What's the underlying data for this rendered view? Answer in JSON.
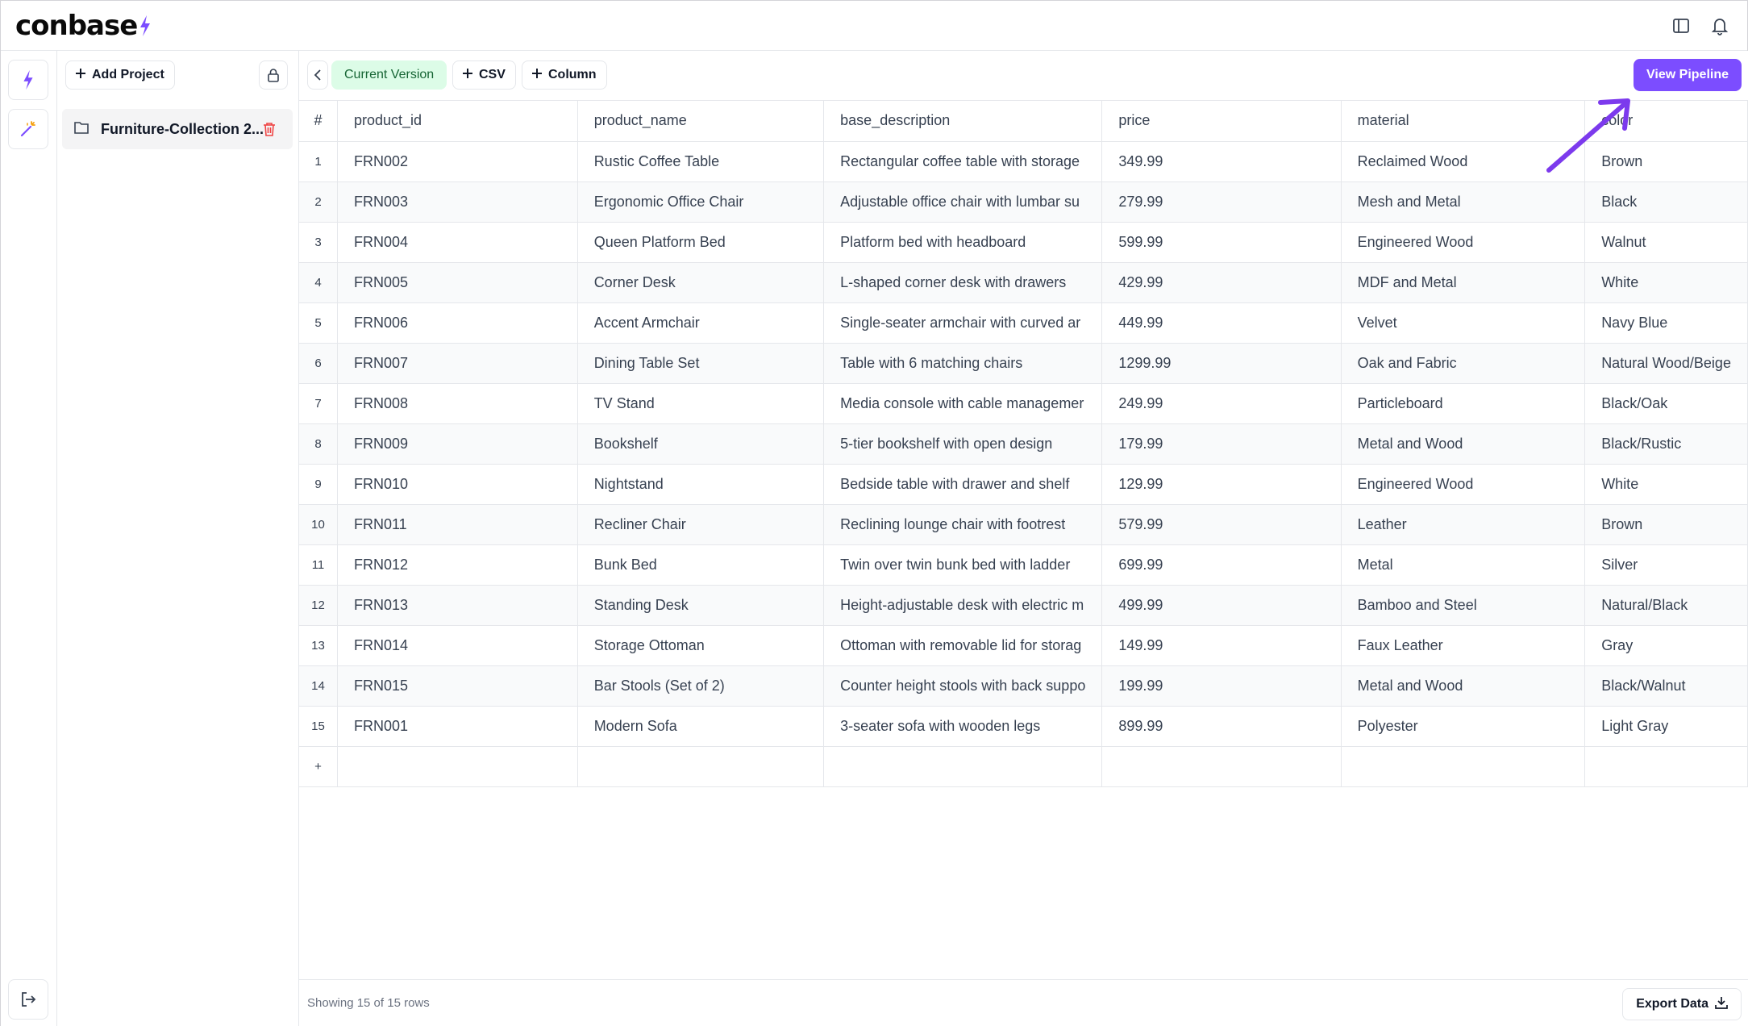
{
  "app": {
    "brand": "conbase"
  },
  "projects": {
    "add_label": "Add Project",
    "items": [
      {
        "name": "Furniture-Collection 2..."
      }
    ]
  },
  "toolbar": {
    "version_label": "Current Version",
    "csv_label": "CSV",
    "column_label": "Column",
    "pipeline_label": "View Pipeline"
  },
  "table": {
    "index_header": "#",
    "columns": [
      "product_id",
      "product_name",
      "base_description",
      "price",
      "material",
      "color"
    ],
    "rows": [
      [
        "1",
        "FRN002",
        "Rustic Coffee Table",
        "Rectangular coffee table with storage",
        "349.99",
        "Reclaimed Wood",
        "Brown"
      ],
      [
        "2",
        "FRN003",
        "Ergonomic Office Chair",
        "Adjustable office chair with lumbar su",
        "279.99",
        "Mesh and Metal",
        "Black"
      ],
      [
        "3",
        "FRN004",
        "Queen Platform Bed",
        "Platform bed with headboard",
        "599.99",
        "Engineered Wood",
        "Walnut"
      ],
      [
        "4",
        "FRN005",
        "Corner Desk",
        "L-shaped corner desk with drawers",
        "429.99",
        "MDF and Metal",
        "White"
      ],
      [
        "5",
        "FRN006",
        "Accent Armchair",
        "Single-seater armchair with curved ar",
        "449.99",
        "Velvet",
        "Navy Blue"
      ],
      [
        "6",
        "FRN007",
        "Dining Table Set",
        "Table with 6 matching chairs",
        "1299.99",
        "Oak and Fabric",
        "Natural Wood/Beige"
      ],
      [
        "7",
        "FRN008",
        "TV Stand",
        "Media console with cable managemer",
        "249.99",
        "Particleboard",
        "Black/Oak"
      ],
      [
        "8",
        "FRN009",
        "Bookshelf",
        "5-tier bookshelf with open design",
        "179.99",
        "Metal and Wood",
        "Black/Rustic"
      ],
      [
        "9",
        "FRN010",
        "Nightstand",
        "Bedside table with drawer and shelf",
        "129.99",
        "Engineered Wood",
        "White"
      ],
      [
        "10",
        "FRN011",
        "Recliner Chair",
        "Reclining lounge chair with footrest",
        "579.99",
        "Leather",
        "Brown"
      ],
      [
        "11",
        "FRN012",
        "Bunk Bed",
        "Twin over twin bunk bed with ladder",
        "699.99",
        "Metal",
        "Silver"
      ],
      [
        "12",
        "FRN013",
        "Standing Desk",
        "Height-adjustable desk with electric m",
        "499.99",
        "Bamboo and Steel",
        "Natural/Black"
      ],
      [
        "13",
        "FRN014",
        "Storage Ottoman",
        "Ottoman with removable lid for storag",
        "149.99",
        "Faux Leather",
        "Gray"
      ],
      [
        "14",
        "FRN015",
        "Bar Stools (Set of 2)",
        "Counter height stools with back suppo",
        "199.99",
        "Metal and Wood",
        "Black/Walnut"
      ],
      [
        "15",
        "FRN001",
        "Modern Sofa",
        "3-seater sofa with wooden legs",
        "899.99",
        "Polyester",
        "Light Gray"
      ]
    ],
    "add_row_symbol": "+"
  },
  "footer": {
    "row_count_text": "Showing 15 of 15 rows",
    "export_label": "Export Data"
  },
  "colors": {
    "accent": "#7c4dff",
    "version_badge_bg": "#dcfce7",
    "version_badge_text": "#166534",
    "trash": "#ef4444"
  }
}
